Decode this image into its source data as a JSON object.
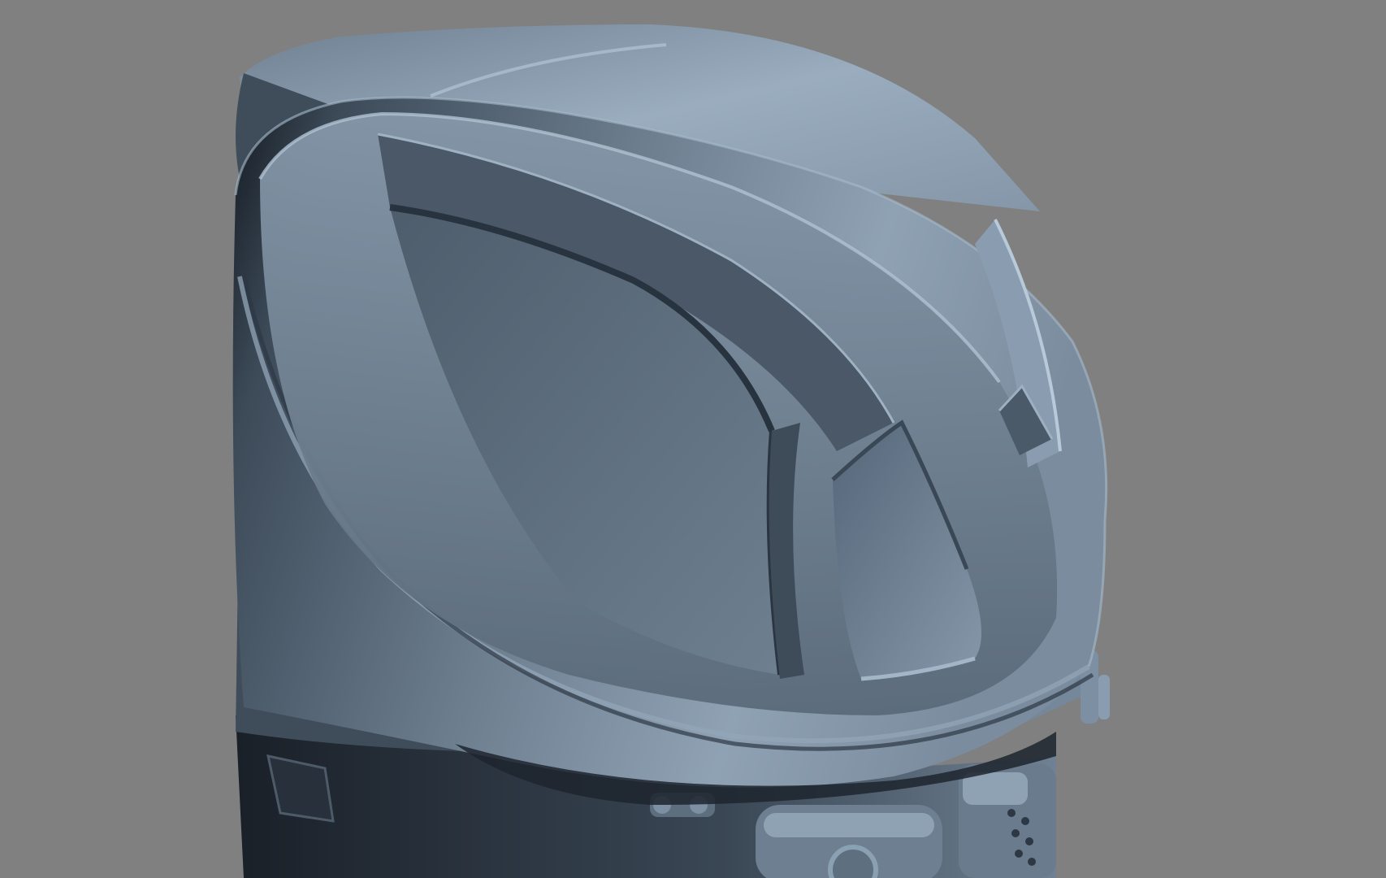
{
  "viewport": {
    "background_color": "#808080",
    "subject": "outboard-motor-cowling-clay-render",
    "material_color": "#7e8fa0",
    "shadow_color": "#1b2129",
    "highlight_color": "#a9bccd"
  }
}
